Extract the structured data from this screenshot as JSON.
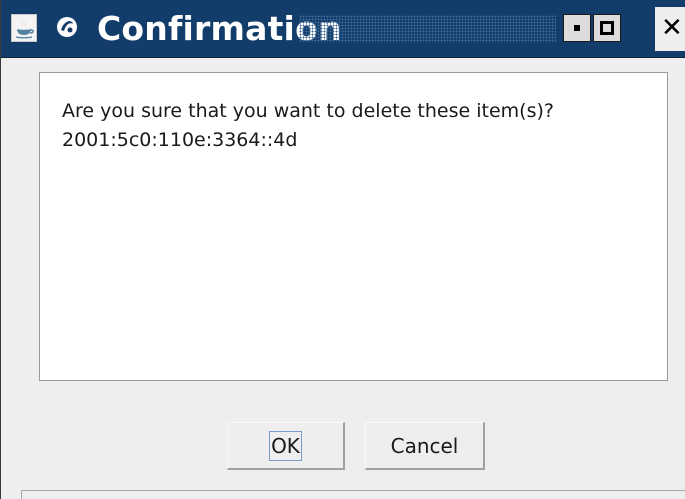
{
  "window": {
    "title": "Confirmation"
  },
  "icons": {
    "java": "java-icon",
    "app": "app-logo-icon",
    "minimize": "minimize-icon",
    "maximize": "maximize-icon",
    "close": "close-icon"
  },
  "titlebar_controls": {
    "close_glyph": "✕"
  },
  "message": {
    "line1": "Are you sure that you want to delete these item(s)?",
    "line2": "2001:5c0:110e:3364::4d"
  },
  "buttons": {
    "ok_label": "OK",
    "cancel_label": "Cancel"
  },
  "colors": {
    "titlebar_bg": "#123c6a",
    "title_text": "#ffffff",
    "window_bg": "#eeeeee",
    "panel_bg": "#ffffff"
  }
}
